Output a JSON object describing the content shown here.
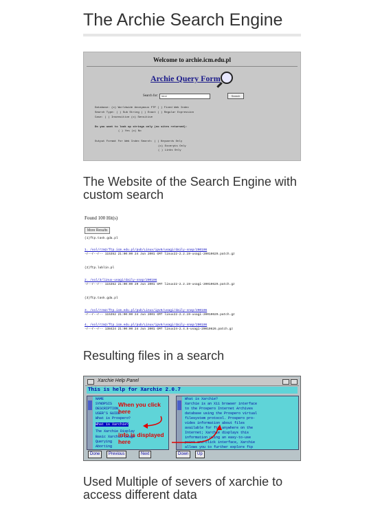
{
  "page_title": "The Archie Search Engine",
  "sections": [
    {
      "caption": "The Website of the Search Engine with custom search",
      "figure": {
        "welcome": "Welcome to archie.icm.edu.pl",
        "form_title": "Archie Query Form",
        "search_for_label": "Search for:",
        "search_value": "html",
        "search_button": "Search",
        "rows": [
          "Database:   (o) Worldwide Anonymous FTP     ( ) Fixed Web Index",
          "Search Type: ( ) Sub String    ( ) Exact    ( ) Regular Expression",
          "Case:       ( ) Insensitive   (o) Sensitive",
          "Do you want to look up strings only (no sites returned):",
          "( ) Yes                 (o) No",
          "Output Format For Web Index Search:  ( ) Keywords Only",
          "(o) Excerpts Only",
          "( ) Links Only"
        ]
      }
    },
    {
      "caption": "Resulting files in a search",
      "figure": {
        "header": "Found 100 Hit(s)",
        "more_button": "More Results",
        "lines": [
          "(1)ftp.task.gda.pl",
          "  1. /vol/rzm2/ftp.icm.edu.pl/pub/Linux/ipv6/usagi/daily-snap/200106",
          "     -r--r--r--    115352     21:00:00 24 Jun 2001 GMT     linux22-2.2.19-usagi-20010629.patch.gz",
          "(2)ftp.lublin.pl",
          "  2. /vol/3/linux-usagi/daily-snap/200106",
          "     -r--r--r--    115352     21:00:00 29 Jun 2001 GMT     linux22-2.2.19-usagi-20010629.patch.gz",
          "(3)ftp.task.gda.pl",
          "  3. /vol/rzm2/ftp.icm.edu.pl/pub/Linux/ipv6/usagi/daily-snap/200106",
          "     -r--r--r--    115352     21:00:00 24 Jun 2001 GMT     linux22-2.2.19-usagi-20010629.patch.gz",
          "  4. /vol/rzm2/ftp.icm.edu.pl/pub/Linux/ipv6/usagi/daily-snap/200106",
          "     -r--r--r--    138424     21:00:00 24 Jun 2001 GMT     linux24-2.4.5-usagi-20010626.patch.gz"
        ]
      }
    },
    {
      "caption": "Used Multiple of severs of xarchie to access different data",
      "figure": {
        "window_title": "Xarchie Help Panel",
        "help_line": "This is help for Xarchie 2.0.7",
        "left_items": [
          "NAME",
          "SYNOPSIS",
          "DESCRIPTION",
          "USER'S GUIDE",
          "What is Prospero?",
          "What is Xarchie?",
          "The Xarchie Display",
          "Basic Xarchie Usage",
          "Querying",
          "Aborting"
        ],
        "selected_index": 5,
        "right_lines": [
          "What is Xarchie?",
          "  Xarchie is an X11 browser interface",
          "  to the Prospero Internet Archives",
          "  database using the Prospero virtual",
          "  filesystem protocol.  Prospero pro-",
          "  vides information about files",
          "  available for ftp anywhere on the",
          "  Internet; Xarchie displays this",
          "  information using an easy-to-use",
          "  point-and-click interface, Xarchie",
          "  allows you to further explore ftp"
        ],
        "annotation_left": "When you click here",
        "annotation_right": "info is displayed here",
        "buttons": [
          "Done",
          "Previous",
          "Next",
          "Down",
          "Up"
        ]
      }
    }
  ]
}
